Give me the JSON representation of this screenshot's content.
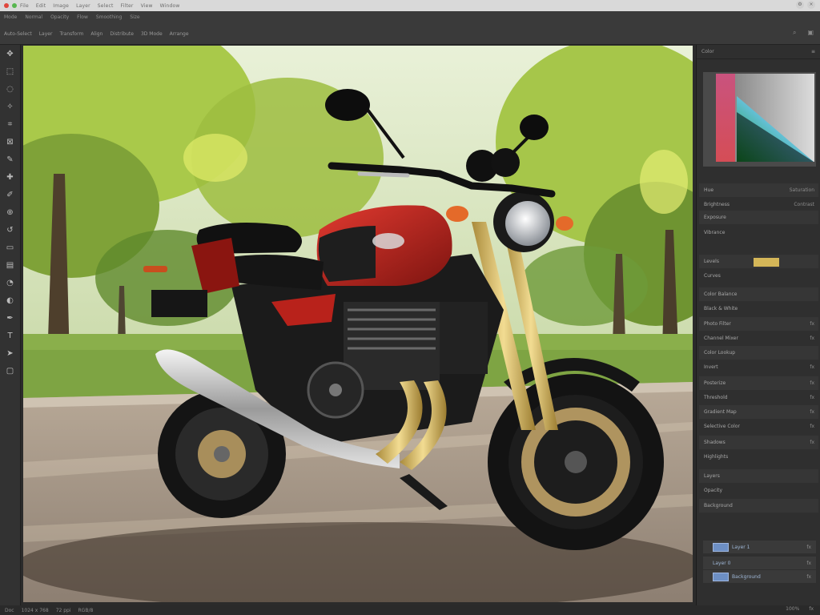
{
  "menubar": {
    "items": [
      "File",
      "Edit",
      "Image",
      "Layer",
      "Select",
      "Filter",
      "View",
      "Window"
    ],
    "dot_colors": [
      "#e0463c",
      "#57b64f"
    ]
  },
  "options_bar": {
    "row1": [
      "Mode",
      "Normal",
      "Opacity",
      "Flow",
      "Smoothing",
      "Size"
    ],
    "row2": [
      "Auto-Select",
      "Layer",
      "Transform",
      "Align",
      "Distribute",
      "3D Mode",
      "Arrange"
    ]
  },
  "toolbar": {
    "tools": [
      {
        "name": "move-tool-icon",
        "glyph": "✥"
      },
      {
        "name": "marquee-tool-icon",
        "glyph": "⬚"
      },
      {
        "name": "lasso-tool-icon",
        "glyph": "◌"
      },
      {
        "name": "magic-wand-tool-icon",
        "glyph": "✧"
      },
      {
        "name": "crop-tool-icon",
        "glyph": "⌗"
      },
      {
        "name": "frame-tool-icon",
        "glyph": "⊠"
      },
      {
        "name": "eyedropper-tool-icon",
        "glyph": "✎"
      },
      {
        "name": "healing-tool-icon",
        "glyph": "✚"
      },
      {
        "name": "brush-tool-icon",
        "glyph": "✐"
      },
      {
        "name": "stamp-tool-icon",
        "glyph": "⊕"
      },
      {
        "name": "history-brush-icon",
        "glyph": "↺"
      },
      {
        "name": "eraser-tool-icon",
        "glyph": "▭"
      },
      {
        "name": "gradient-tool-icon",
        "glyph": "▤"
      },
      {
        "name": "blur-tool-icon",
        "glyph": "◔"
      },
      {
        "name": "dodge-tool-icon",
        "glyph": "◐"
      },
      {
        "name": "pen-tool-icon",
        "glyph": "✒"
      },
      {
        "name": "type-tool-icon",
        "glyph": "T"
      },
      {
        "name": "path-select-icon",
        "glyph": "➤"
      },
      {
        "name": "shape-tool-icon",
        "glyph": "▢"
      }
    ]
  },
  "panel": {
    "header": "Color",
    "header_icons": [
      "≡",
      "×"
    ],
    "properties": [
      {
        "label": "Hue",
        "value": "Saturation"
      },
      {
        "label": "Brightness",
        "value": "Contrast"
      },
      {
        "label": "Exposure",
        "value": ""
      },
      {
        "label": "Vibrance",
        "value": ""
      },
      {
        "label": "Levels",
        "value": ""
      },
      {
        "label": "Curves",
        "value": ""
      },
      {
        "label": "Color Balance",
        "value": ""
      },
      {
        "label": "Black & White",
        "value": ""
      },
      {
        "label": "Photo Filter",
        "value": "fx"
      },
      {
        "label": "Channel Mixer",
        "value": "fx"
      },
      {
        "label": "Color Lookup",
        "value": ""
      },
      {
        "label": "Invert",
        "value": "fx"
      },
      {
        "label": "Posterize",
        "value": "fx"
      },
      {
        "label": "Threshold",
        "value": "fx"
      },
      {
        "label": "Gradient Map",
        "value": "fx"
      },
      {
        "label": "Selective Color",
        "value": "fx"
      },
      {
        "label": "Shadows",
        "value": "fx"
      },
      {
        "label": "Highlights",
        "value": ""
      },
      {
        "label": "Layers",
        "value": ""
      },
      {
        "label": "Opacity",
        "value": ""
      },
      {
        "label": "Background",
        "value": ""
      }
    ],
    "layers": [
      {
        "label": "Layer 1",
        "value": "fx"
      },
      {
        "label": "Layer 0",
        "value": "fx"
      },
      {
        "label": "Background",
        "value": "fx"
      }
    ]
  },
  "statusbar": {
    "left": [
      "Doc",
      "1024 x 768",
      "72 ppi",
      "RGB/8"
    ],
    "right": [
      "100%",
      "fx"
    ]
  }
}
